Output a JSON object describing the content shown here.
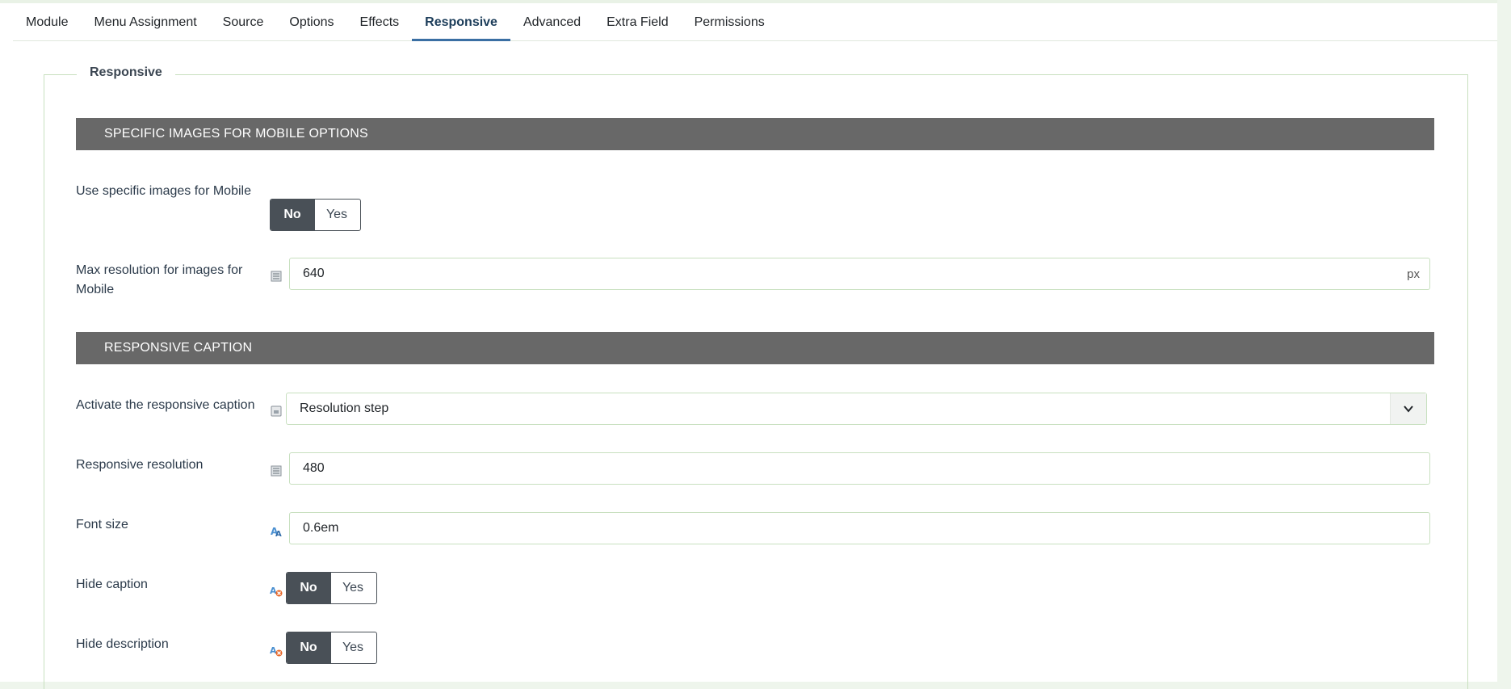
{
  "tabs": [
    {
      "label": "Module",
      "active": false
    },
    {
      "label": "Menu Assignment",
      "active": false
    },
    {
      "label": "Source",
      "active": false
    },
    {
      "label": "Options",
      "active": false
    },
    {
      "label": "Effects",
      "active": false
    },
    {
      "label": "Responsive",
      "active": true
    },
    {
      "label": "Advanced",
      "active": false
    },
    {
      "label": "Extra Field",
      "active": false
    },
    {
      "label": "Permissions",
      "active": false
    }
  ],
  "fieldset": {
    "legend": "Responsive",
    "sections": [
      {
        "title": "SPECIFIC IMAGES FOR MOBILE OPTIONS"
      },
      {
        "title": "RESPONSIVE CAPTION"
      }
    ]
  },
  "fields": {
    "use_mobile_images": {
      "label": "Use specific images for Mobile",
      "no": "No",
      "yes": "Yes",
      "value": "No"
    },
    "max_resolution": {
      "label_line1": "Max resolution for images for",
      "label_line2": "Mobile",
      "value": "640",
      "suffix": "px",
      "icon": "list-icon"
    },
    "activate_caption": {
      "label": "Activate the responsive caption",
      "value": "Resolution step",
      "icon": "select-icon"
    },
    "responsive_resolution": {
      "label": "Responsive resolution",
      "value": "480",
      "icon": "list-icon"
    },
    "font_size": {
      "label": "Font size",
      "value": "0.6em",
      "icon": "font-icon"
    },
    "hide_caption": {
      "label": "Hide caption",
      "no": "No",
      "yes": "Yes",
      "value": "No",
      "icon": "font-hide-icon"
    },
    "hide_description": {
      "label": "Hide description",
      "no": "No",
      "yes": "Yes",
      "value": "No",
      "icon": "font-hide-icon"
    }
  },
  "colors": {
    "accent": "#3a6fa3",
    "header_bg": "#686868",
    "toggle_on": "#495057",
    "border": "#c8e0bf"
  }
}
